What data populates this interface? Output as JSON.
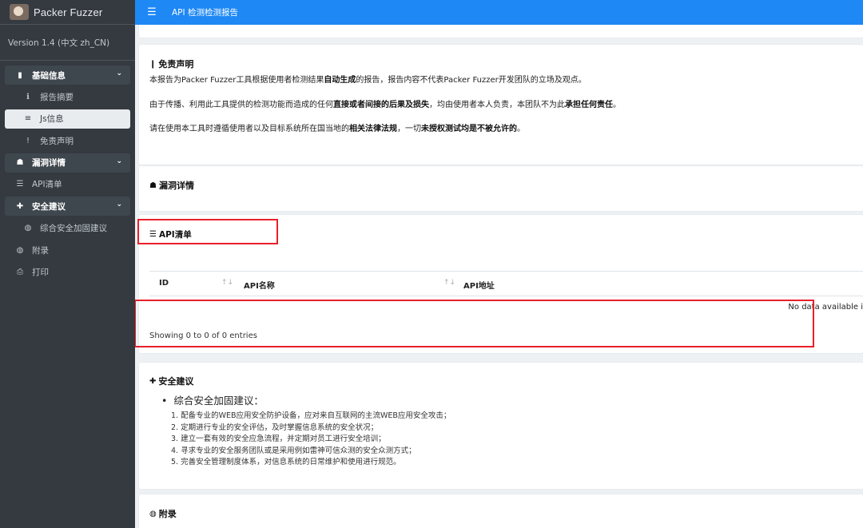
{
  "brand": {
    "name": "Packer Fuzzer"
  },
  "version": "Version 1.4 (中文 zh_CN)",
  "header": {
    "title": "API 检测检测报告"
  },
  "sidebar": {
    "items": [
      {
        "label": "基础信息",
        "icon": "document-icon"
      },
      {
        "label": "报告摘要",
        "icon": "info-icon"
      },
      {
        "label": "Js信息",
        "icon": "database-icon"
      },
      {
        "label": "免责声明",
        "icon": "exclamation-icon"
      },
      {
        "label": "漏洞详情",
        "icon": "bug-icon"
      },
      {
        "label": "API清单",
        "icon": "list-icon"
      },
      {
        "label": "安全建议",
        "icon": "plus-icon"
      },
      {
        "label": "综合安全加固建议",
        "icon": "globe-icon"
      },
      {
        "label": "附录",
        "icon": "globe-icon"
      },
      {
        "label": "打印",
        "icon": "print-icon"
      }
    ]
  },
  "disclaimer": {
    "title": "免责声明",
    "p1_a": "本报告为Packer Fuzzer工具根据使用者检测结果",
    "p1_b": "自动生成",
    "p1_c": "的报告，报告内容不代表Packer Fuzzer开发团队的立场及观点。",
    "p2_a": "由于传播、利用此工具提供的检测功能而造成的任何",
    "p2_b": "直接或者间接的后果及损失",
    "p2_c": "，均由使用者本人负责，本团队不为此",
    "p2_d": "承担任何责任",
    "p2_e": "。",
    "p3_a": "请在使用本工具时遵循使用者以及目标系统所在国当地的",
    "p3_b": "相关法律法规",
    "p3_c": "，一切",
    "p3_d": "未授权测试均是不被允许的",
    "p3_e": "。"
  },
  "vuln": {
    "title": "漏洞详情"
  },
  "api_list": {
    "title": "API清单",
    "columns": [
      "ID",
      "API名称",
      "API地址"
    ],
    "empty_text": "No data available i",
    "info_text": "Showing 0 to 0 of 0 entries"
  },
  "security": {
    "title": "安全建议",
    "subtitle": "综合安全加固建议：",
    "steps": [
      "1. 配备专业的WEB应用安全防护设备，应对来自互联网的主流WEB应用安全攻击；",
      "2. 定期进行专业的安全评估，及时掌握信息系统的安全状况；",
      "3. 建立一套有效的安全应急流程，并定期对员工进行安全培训；",
      "4. 寻求专业的安全服务团队或是采用例如雷神可信众测的安全众测方式；",
      "5. 完善安全管理制度体系，对信息系统的日常维护和使用进行规范。"
    ]
  },
  "appendix": {
    "title": "附录"
  },
  "colors": {
    "topbar": "#1e88f5",
    "sidebar": "#343a40",
    "highlight": "#e8202a"
  }
}
